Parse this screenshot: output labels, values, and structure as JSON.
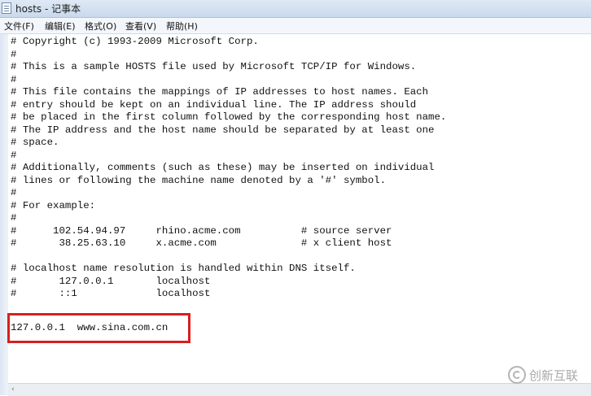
{
  "window": {
    "title": "hosts - 记事本"
  },
  "menu": [
    {
      "label": "文件(F)"
    },
    {
      "label": "编辑(E)"
    },
    {
      "label": "格式(O)"
    },
    {
      "label": "查看(V)"
    },
    {
      "label": "帮助(H)"
    }
  ],
  "editor": {
    "content": "# Copyright (c) 1993-2009 Microsoft Corp.\n#\n# This is a sample HOSTS file used by Microsoft TCP/IP for Windows.\n#\n# This file contains the mappings of IP addresses to host names. Each\n# entry should be kept on an individual line. The IP address should\n# be placed in the first column followed by the corresponding host name.\n# The IP address and the host name should be separated by at least one\n# space.\n#\n# Additionally, comments (such as these) may be inserted on individual\n# lines or following the machine name denoted by a '#' symbol.\n#\n# For example:\n#\n#      102.54.94.97     rhino.acme.com          # source server\n#       38.25.63.10     x.acme.com              # x client host\n\n# localhost name resolution is handled within DNS itself.\n#       127.0.0.1       localhost\n#       ::1             localhost",
    "added_entry": "127.0.0.1  www.sina.com.cn"
  },
  "scrollbar": {
    "left_arrow": "‹"
  },
  "watermark": {
    "text": "创新互联"
  },
  "colors": {
    "highlight_border": "#d81f1f",
    "titlebar": "#d5e2f1",
    "editor_background": "#ffffff"
  }
}
